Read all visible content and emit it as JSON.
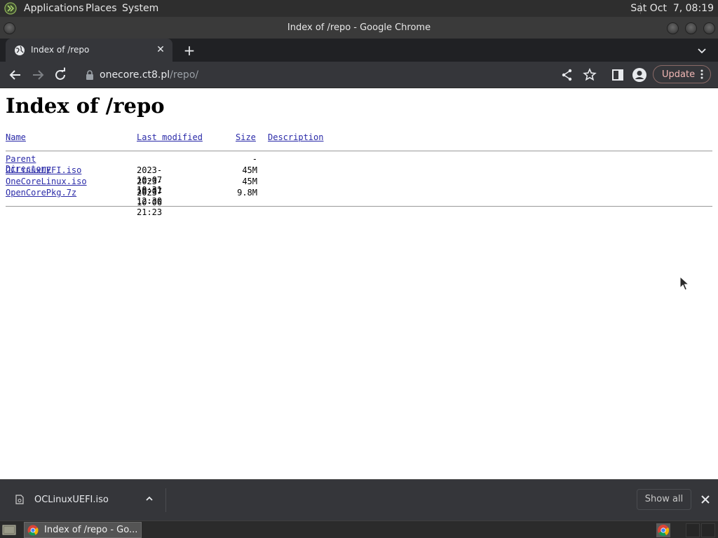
{
  "system_panel": {
    "menus": [
      "Applications",
      "Places",
      "System"
    ],
    "clock": "Sat Oct  7, 08:19"
  },
  "window": {
    "title": "Index of /repo - Google Chrome"
  },
  "tab": {
    "title": "Index of /repo",
    "close": "✕",
    "new_tab": "+"
  },
  "address_bar": {
    "host": "onecore.ct8.pl",
    "path": "/repo/"
  },
  "toolbar": {
    "update_label": "Update"
  },
  "page": {
    "heading": "Index of /repo",
    "columns": {
      "name": "Name",
      "last_modified": "Last modified",
      "size": "Size",
      "description": "Description"
    },
    "parent": {
      "name": "Parent Directory",
      "size": "-"
    },
    "rows": [
      {
        "name": "OCLinuxUEFI.iso",
        "modified": "2023-10-07 10:31",
        "size": "45M"
      },
      {
        "name": "OneCoreLinux.iso",
        "modified": "2023-10-07 12:30",
        "size": "45M"
      },
      {
        "name": "OpenCorePkg.7z",
        "modified": "2023-10-06 21:23",
        "size": "9.8M"
      }
    ]
  },
  "download_shelf": {
    "file_name": "OCLinuxUEFI.iso",
    "show_all": "Show all"
  },
  "taskbar": {
    "window_button": "Index of /repo - Go..."
  },
  "colors": {
    "link": "#2a2aa8",
    "update_accent": "#f2b8b5",
    "chrome_dark": "#35363a"
  }
}
